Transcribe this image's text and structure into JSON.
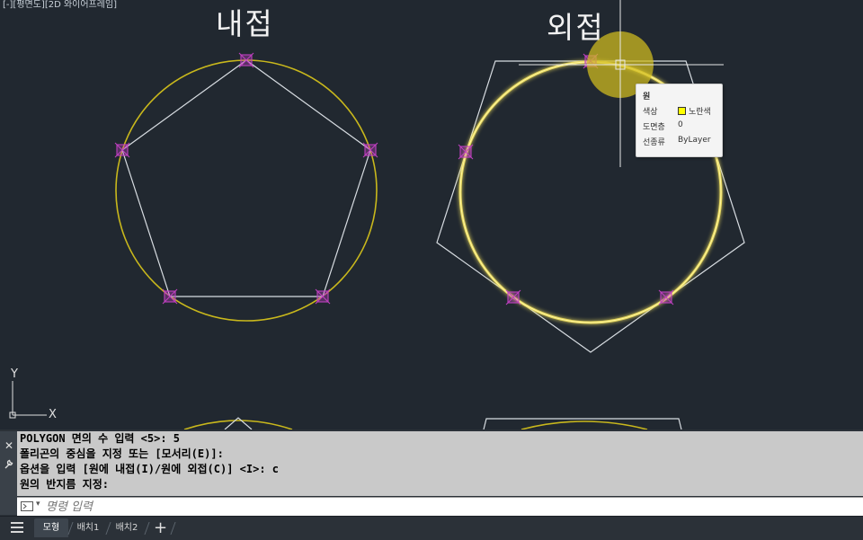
{
  "viewport": {
    "label": "[-][평면도][2D 와이어프레임]",
    "titles": {
      "left": "내접",
      "right": "외접"
    },
    "ucs": {
      "x_label": "X",
      "y_label": "Y"
    }
  },
  "tooltip": {
    "title": "원",
    "rows": [
      {
        "key": "색상",
        "value": "노란색",
        "swatch_color": "#ffff00"
      },
      {
        "key": "도면층",
        "value": "0"
      },
      {
        "key": "선종류",
        "value": "ByLayer"
      }
    ]
  },
  "command": {
    "history": [
      "POLYGON 면의 수 입력 <5>: 5",
      "폴리곤의 중심을 지정 또는 [모서리(E)]:",
      "옵션을 입력 [원에 내접(I)/원에 외접(C)] <I>: c",
      "원의 반지름 지정:"
    ],
    "input_placeholder": "명령 입력"
  },
  "layout_tabs": {
    "tabs": [
      {
        "label": "모형",
        "active": true
      },
      {
        "label": "배치1",
        "active": false
      },
      {
        "label": "배치2",
        "active": false
      }
    ],
    "add_label": "+"
  },
  "colors": {
    "background": "#212830",
    "circle": "#c9b81c",
    "polygon": "#d8dde2",
    "grip": "#c040c0",
    "highlight": "#e6d024"
  }
}
